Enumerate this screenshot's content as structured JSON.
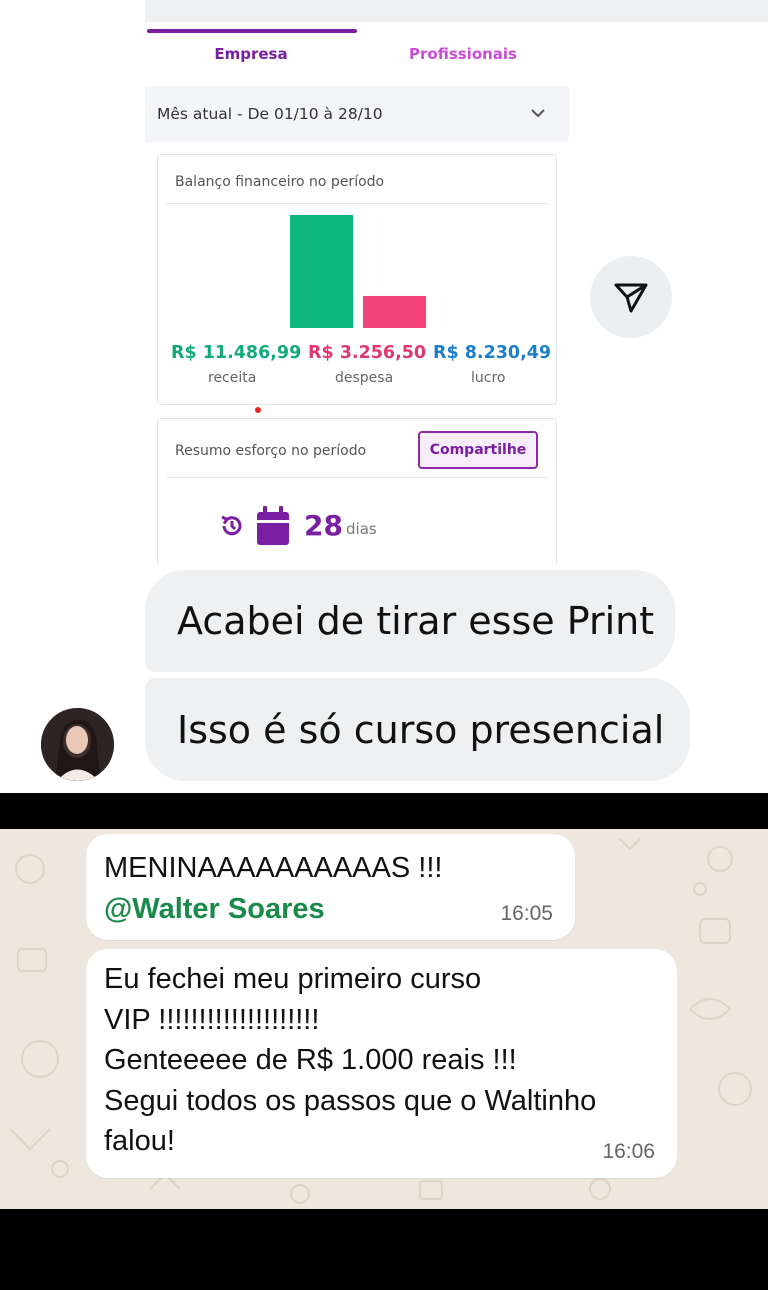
{
  "app": {
    "tabs": [
      {
        "label": "Empresa",
        "active": true
      },
      {
        "label": "Profissionais",
        "active": false
      }
    ],
    "period_select": {
      "value": "Mês atual - De 01/10 à 28/10"
    },
    "finance_card": {
      "title": "Balanço financeiro no período"
    },
    "effort_card": {
      "title": "Resumo esforço no período",
      "share_label": "Compartilhe",
      "days_value": "28",
      "days_unit": "dias"
    }
  },
  "chart_data": {
    "type": "bar",
    "categories": [
      "receita",
      "despesa"
    ],
    "values": [
      11486.99,
      3256.5
    ],
    "colors": [
      "#0bb57c",
      "#f2437a"
    ],
    "value_labels": [
      "R$ 11.486,99",
      "R$ 3.256,50",
      "R$ 8.230,49"
    ],
    "captions": [
      "receita",
      "despesa",
      "lucro"
    ],
    "label_colors": [
      "#12a97b",
      "#e23870",
      "#1d7fc9"
    ]
  },
  "chat": {
    "messages": [
      {
        "text": "Acabei de tirar esse Print"
      },
      {
        "text": "Isso é só curso presencial"
      }
    ],
    "send_icon": "send-icon"
  },
  "whatsapp": {
    "messages": [
      {
        "line1": "MENINAAAAAAAAAAS !!!",
        "mention": "@Walter Soares",
        "time": "16:05"
      },
      {
        "lines": [
          "Eu fechei meu primeiro curso",
          "VIP !!!!!!!!!!!!!!!!!!!!",
          "Genteeeee de R$ 1.000 reais !!!",
          "Segui todos os passos que o Waltinho",
          "falou!"
        ],
        "time": "16:06"
      }
    ]
  }
}
